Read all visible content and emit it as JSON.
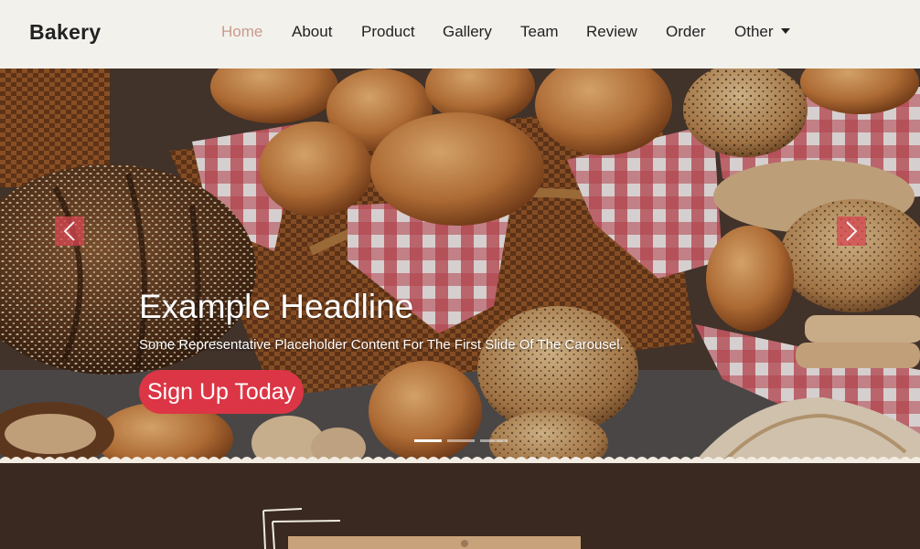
{
  "navbar": {
    "brand": "Bakery",
    "links": [
      {
        "label": "Home",
        "active": true
      },
      {
        "label": "About"
      },
      {
        "label": "Product"
      },
      {
        "label": "Gallery"
      },
      {
        "label": "Team"
      },
      {
        "label": "Review"
      },
      {
        "label": "Order"
      },
      {
        "label": "Other",
        "dropdown": true
      }
    ]
  },
  "hero": {
    "headline": "Example Headline",
    "subtext": "Some Representative Placeholder Content For The First Slide Of The Carousel.",
    "cta_label": "Sign Up Today",
    "slide_count": 3,
    "active_slide": 1,
    "prev_icon": "chevron-left-icon",
    "next_icon": "chevron-right-icon"
  },
  "colors": {
    "nav_bg": "#f3f1ec",
    "active_link": "#c99a8a",
    "cta": "#dc3545",
    "dark_section": "#392920"
  }
}
